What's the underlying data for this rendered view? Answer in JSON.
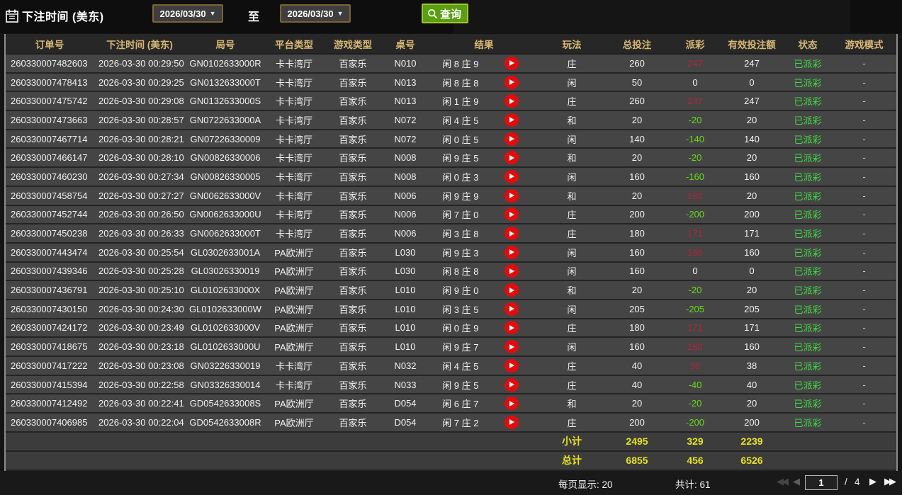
{
  "topbar": {
    "filter_label": "下注时间 (美东)",
    "date_from": "2026/03/30",
    "date_to": "2026/03/30",
    "to_label": "至",
    "search_label": "查询"
  },
  "table": {
    "headers": [
      "订单号",
      "下注时间 (美东)",
      "局号",
      "平台类型",
      "游戏类型",
      "桌号",
      "结果",
      "玩法",
      "总投注",
      "派彩",
      "有效投注额",
      "状态",
      "游戏模式"
    ],
    "rows": [
      {
        "order": "260330007482603",
        "time": "2026-03-30 00:29:50",
        "round": "GN0102633000R",
        "platform": "卡卡湾厅",
        "game": "百家乐",
        "table_no": "N010",
        "result": "闲 8 庄 9",
        "play": "庄",
        "bet": "260",
        "payout": "247",
        "valid": "247",
        "status": "已派彩",
        "mode": "-"
      },
      {
        "order": "260330007478413",
        "time": "2026-03-30 00:29:25",
        "round": "GN0132633000T",
        "platform": "卡卡湾厅",
        "game": "百家乐",
        "table_no": "N013",
        "result": "闲 8 庄 8",
        "play": "闲",
        "bet": "50",
        "payout": "0",
        "valid": "0",
        "status": "已派彩",
        "mode": "-"
      },
      {
        "order": "260330007475742",
        "time": "2026-03-30 00:29:08",
        "round": "GN0132633000S",
        "platform": "卡卡湾厅",
        "game": "百家乐",
        "table_no": "N013",
        "result": "闲 1 庄 9",
        "play": "庄",
        "bet": "260",
        "payout": "247",
        "valid": "247",
        "status": "已派彩",
        "mode": "-"
      },
      {
        "order": "260330007473663",
        "time": "2026-03-30 00:28:57",
        "round": "GN0722633000A",
        "platform": "卡卡湾厅",
        "game": "百家乐",
        "table_no": "N072",
        "result": "闲 4 庄 5",
        "play": "和",
        "bet": "20",
        "payout": "-20",
        "valid": "20",
        "status": "已派彩",
        "mode": "-"
      },
      {
        "order": "260330007467714",
        "time": "2026-03-30 00:28:21",
        "round": "GN07226330009",
        "platform": "卡卡湾厅",
        "game": "百家乐",
        "table_no": "N072",
        "result": "闲 0 庄 5",
        "play": "闲",
        "bet": "140",
        "payout": "-140",
        "valid": "140",
        "status": "已派彩",
        "mode": "-"
      },
      {
        "order": "260330007466147",
        "time": "2026-03-30 00:28:10",
        "round": "GN00826330006",
        "platform": "卡卡湾厅",
        "game": "百家乐",
        "table_no": "N008",
        "result": "闲 9 庄 5",
        "play": "和",
        "bet": "20",
        "payout": "-20",
        "valid": "20",
        "status": "已派彩",
        "mode": "-"
      },
      {
        "order": "260330007460230",
        "time": "2026-03-30 00:27:34",
        "round": "GN00826330005",
        "platform": "卡卡湾厅",
        "game": "百家乐",
        "table_no": "N008",
        "result": "闲 0 庄 3",
        "play": "闲",
        "bet": "160",
        "payout": "-160",
        "valid": "160",
        "status": "已派彩",
        "mode": "-"
      },
      {
        "order": "260330007458754",
        "time": "2026-03-30 00:27:27",
        "round": "GN0062633000V",
        "platform": "卡卡湾厅",
        "game": "百家乐",
        "table_no": "N006",
        "result": "闲 9 庄 9",
        "play": "和",
        "bet": "20",
        "payout": "160",
        "valid": "20",
        "status": "已派彩",
        "mode": "-"
      },
      {
        "order": "260330007452744",
        "time": "2026-03-30 00:26:50",
        "round": "GN0062633000U",
        "platform": "卡卡湾厅",
        "game": "百家乐",
        "table_no": "N006",
        "result": "闲 7 庄 0",
        "play": "庄",
        "bet": "200",
        "payout": "-200",
        "valid": "200",
        "status": "已派彩",
        "mode": "-"
      },
      {
        "order": "260330007450238",
        "time": "2026-03-30 00:26:33",
        "round": "GN0062633000T",
        "platform": "卡卡湾厅",
        "game": "百家乐",
        "table_no": "N006",
        "result": "闲 3 庄 8",
        "play": "庄",
        "bet": "180",
        "payout": "171",
        "valid": "171",
        "status": "已派彩",
        "mode": "-"
      },
      {
        "order": "260330007443474",
        "time": "2026-03-30 00:25:54",
        "round": "GL0302633001A",
        "platform": "PA欧洲厅",
        "game": "百家乐",
        "table_no": "L030",
        "result": "闲 9 庄 3",
        "play": "闲",
        "bet": "160",
        "payout": "160",
        "valid": "160",
        "status": "已派彩",
        "mode": "-"
      },
      {
        "order": "260330007439346",
        "time": "2026-03-30 00:25:28",
        "round": "GL03026330019",
        "platform": "PA欧洲厅",
        "game": "百家乐",
        "table_no": "L030",
        "result": "闲 8 庄 8",
        "play": "闲",
        "bet": "160",
        "payout": "0",
        "valid": "0",
        "status": "已派彩",
        "mode": "-"
      },
      {
        "order": "260330007436791",
        "time": "2026-03-30 00:25:10",
        "round": "GL0102633000X",
        "platform": "PA欧洲厅",
        "game": "百家乐",
        "table_no": "L010",
        "result": "闲 9 庄 0",
        "play": "和",
        "bet": "20",
        "payout": "-20",
        "valid": "20",
        "status": "已派彩",
        "mode": "-"
      },
      {
        "order": "260330007430150",
        "time": "2026-03-30 00:24:30",
        "round": "GL0102633000W",
        "platform": "PA欧洲厅",
        "game": "百家乐",
        "table_no": "L010",
        "result": "闲 3 庄 5",
        "play": "闲",
        "bet": "205",
        "payout": "-205",
        "valid": "205",
        "status": "已派彩",
        "mode": "-"
      },
      {
        "order": "260330007424172",
        "time": "2026-03-30 00:23:49",
        "round": "GL0102633000V",
        "platform": "PA欧洲厅",
        "game": "百家乐",
        "table_no": "L010",
        "result": "闲 0 庄 9",
        "play": "庄",
        "bet": "180",
        "payout": "171",
        "valid": "171",
        "status": "已派彩",
        "mode": "-"
      },
      {
        "order": "260330007418675",
        "time": "2026-03-30 00:23:18",
        "round": "GL0102633000U",
        "platform": "PA欧洲厅",
        "game": "百家乐",
        "table_no": "L010",
        "result": "闲 9 庄 7",
        "play": "闲",
        "bet": "160",
        "payout": "160",
        "valid": "160",
        "status": "已派彩",
        "mode": "-"
      },
      {
        "order": "260330007417222",
        "time": "2026-03-30 00:23:08",
        "round": "GN03226330019",
        "platform": "卡卡湾厅",
        "game": "百家乐",
        "table_no": "N032",
        "result": "闲 4 庄 5",
        "play": "庄",
        "bet": "40",
        "payout": "38",
        "valid": "38",
        "status": "已派彩",
        "mode": "-"
      },
      {
        "order": "260330007415394",
        "time": "2026-03-30 00:22:58",
        "round": "GN03326330014",
        "platform": "卡卡湾厅",
        "game": "百家乐",
        "table_no": "N033",
        "result": "闲 9 庄 5",
        "play": "庄",
        "bet": "40",
        "payout": "-40",
        "valid": "40",
        "status": "已派彩",
        "mode": "-"
      },
      {
        "order": "260330007412492",
        "time": "2026-03-30 00:22:41",
        "round": "GD0542633008S",
        "platform": "PA欧洲厅",
        "game": "百家乐",
        "table_no": "D054",
        "result": "闲 6 庄 7",
        "play": "和",
        "bet": "20",
        "payout": "-20",
        "valid": "20",
        "status": "已派彩",
        "mode": "-"
      },
      {
        "order": "260330007406985",
        "time": "2026-03-30 00:22:04",
        "round": "GD0542633008R",
        "platform": "PA欧洲厅",
        "game": "百家乐",
        "table_no": "D054",
        "result": "闲 7 庄 2",
        "play": "庄",
        "bet": "200",
        "payout": "-200",
        "valid": "200",
        "status": "已派彩",
        "mode": "-"
      }
    ],
    "subtotal": {
      "label": "小计",
      "bet": "2495",
      "payout": "329",
      "valid": "2239"
    },
    "total": {
      "label": "总计",
      "bet": "6855",
      "payout": "456",
      "valid": "6526"
    }
  },
  "pagination": {
    "per_page": "每页显示: 20",
    "total_count": "共计: 61",
    "current_page": "1",
    "separator": "/",
    "total_pages": "4"
  },
  "colors": {
    "win_red": "#b0243a",
    "loss_green": "#63dd15",
    "status_green": "#41d943",
    "totals_yellow": "#e6e31f",
    "header_gold": "#d8b873",
    "button_green": "#5a9e12",
    "play_icon_red": "#e60a0a"
  }
}
